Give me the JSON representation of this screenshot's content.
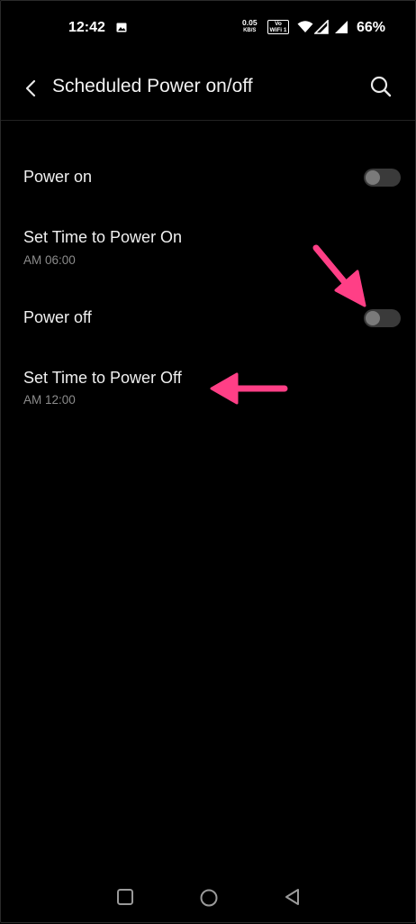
{
  "status_bar": {
    "time": "12:42",
    "net_speed_value": "0.05",
    "net_speed_unit": "KB/S",
    "volte_line1": "Vo",
    "volte_line2": "WiFi 1",
    "battery": "66%"
  },
  "toolbar": {
    "title": "Scheduled Power on/off"
  },
  "settings": [
    {
      "type": "toggle",
      "label": "Power on",
      "checked": false
    },
    {
      "type": "item",
      "label": "Set Time to Power On",
      "value": "AM 06:00"
    },
    {
      "type": "toggle",
      "label": "Power off",
      "checked": false
    },
    {
      "type": "item",
      "label": "Set Time to Power Off",
      "value": "AM 12:00"
    }
  ],
  "colors": {
    "background": "#000000",
    "annotation_arrow": "#ff3f86",
    "toggle_track": "#3a3a3a",
    "toggle_knob": "#7a7a7a",
    "secondary_text": "#8c8c8c"
  },
  "icons": {
    "back": "back-arrow-icon",
    "search": "search-icon",
    "nav_recents": "square-icon",
    "nav_home": "circle-icon",
    "nav_back": "triangle-back-icon"
  }
}
